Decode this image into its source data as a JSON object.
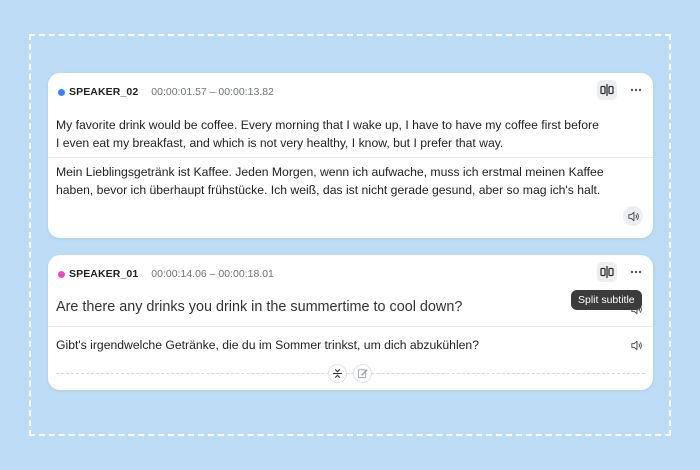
{
  "segments": [
    {
      "speaker": "SPEAKER_02",
      "speaker_color": "#3b82f6",
      "time_range": "00:00:01.57 – 00:00:13.82",
      "original_lines": [
        "My favorite drink would be coffee. Every morning that I wake up, I have to have my coffee first before",
        "I even eat my breakfast, and which is not very healthy, I know, but I prefer that way."
      ],
      "translation_lines": [
        "Mein Lieblingsgetränk ist Kaffee. Jeden Morgen, wenn ich aufwache, muss ich erstmal meinen Kaffee",
        "haben, bevor ich überhaupt frühstücke. Ich weiß, das ist nicht gerade gesund, aber so mag ich's halt."
      ]
    },
    {
      "speaker": "SPEAKER_01",
      "speaker_color": "#e84bc4",
      "time_range": "00:00:14.06 – 00:00:18.01",
      "original_lines": [
        "Are there any drinks you drink in the summertime to cool down?"
      ],
      "translation_lines": [
        "Gibt's irgendwelche Getränke, die du im Sommer trinkst, um dich abzukühlen?"
      ]
    }
  ],
  "tooltip": {
    "text": "Split subtitle"
  },
  "icons": {
    "split": "split-subtitle-icon",
    "more": "more-horizontal-icon",
    "speaker": "speaker-volume-icon",
    "merge": "merge-icon",
    "edit": "edit-icon"
  }
}
